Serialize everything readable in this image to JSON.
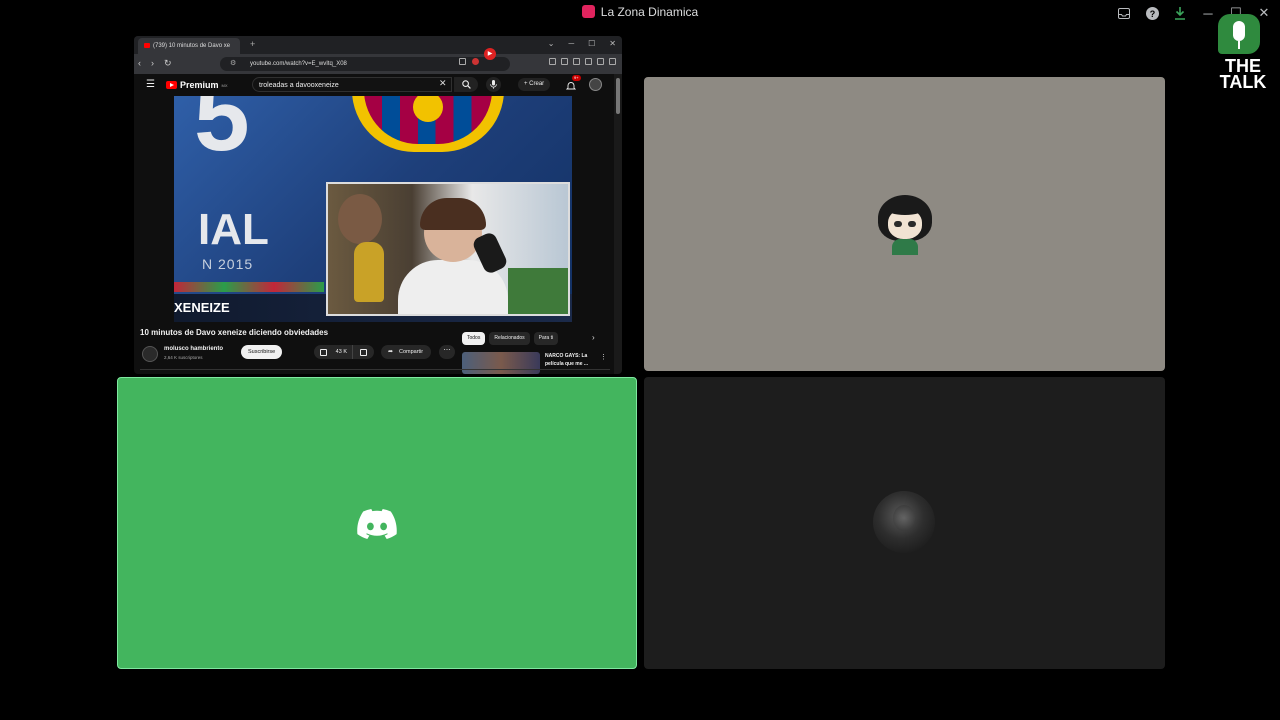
{
  "window": {
    "title": "La Zona Dinamica",
    "icons": [
      "inbox-icon",
      "help-icon",
      "download-icon",
      "minimize-icon",
      "maximize-icon",
      "close-icon"
    ],
    "minimize": "─",
    "maximize": "☐",
    "close": "✕",
    "help": "?"
  },
  "browser": {
    "tab_title": "(739) 10 minutos de Davo xe",
    "new_tab": "+",
    "url": "youtube.com/watch?v=E_wvItq_X08",
    "win_controls": [
      "⌄",
      "─",
      "☐",
      "✕"
    ]
  },
  "youtube": {
    "logo_label": "Premium",
    "logo_sup": "MX",
    "search_value": "troleadas a davooxeneize",
    "create_label": "Crear",
    "notifications_badge": "9+",
    "video_title": "10 minutos de Davo xeneize diciendo obviedades",
    "channel_name": "molusco hambriento",
    "channel_subs": "2,64 K suscriptores",
    "subscribe_label": "Suscribirse",
    "like_count": "43 K",
    "share_label": "Compartir",
    "chips": [
      "Todos",
      "Relacionados",
      "Para ti"
    ],
    "related_title": "NARCO GAYS: La película que me ...",
    "video_overlay": {
      "number": "5",
      "word": "IAL",
      "year": "N 2015",
      "bottom": "XENEIZE"
    }
  },
  "watermark": {
    "line1": "THE",
    "line2": "TALK"
  },
  "colors": {
    "discord_green": "#43b55e",
    "tile_gray": "#8e8a83",
    "tile_dark": "#1d1d1d",
    "accent_red": "#e0245e"
  }
}
